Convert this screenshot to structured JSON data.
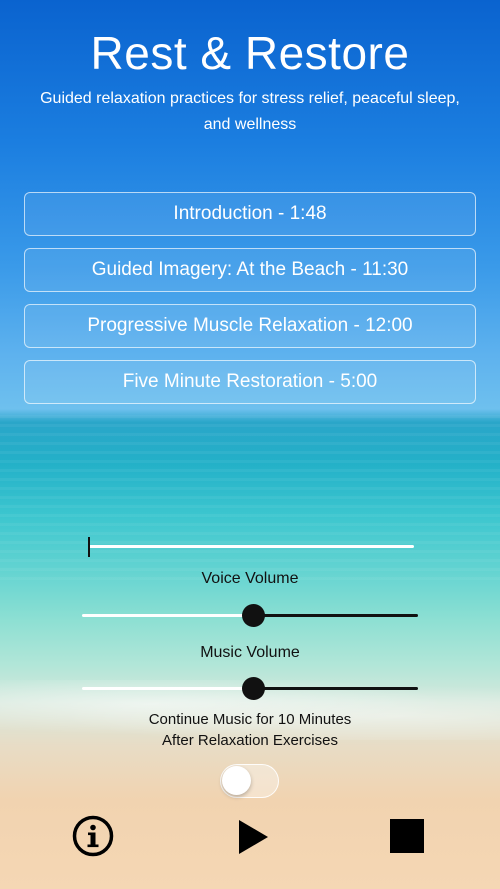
{
  "header": {
    "title": "Rest & Restore",
    "subtitle": "Guided relaxation practices for stress relief, peaceful sleep, and wellness"
  },
  "tracks": [
    {
      "label": "Introduction - 1:48"
    },
    {
      "label": "Guided Imagery: At the Beach - 11:30"
    },
    {
      "label": "Progressive Muscle Relaxation - 12:00"
    },
    {
      "label": "Five Minute Restoration - 5:00"
    }
  ],
  "playback": {
    "progress": 0
  },
  "voice_volume": {
    "label": "Voice Volume",
    "value": 0.51
  },
  "music_volume": {
    "label": "Music Volume",
    "value": 0.51
  },
  "continue_music": {
    "line1": "Continue Music for 10 Minutes",
    "line2": "After Relaxation Exercises",
    "enabled": false
  },
  "controls": {
    "info_icon": "info-circle-icon",
    "play_icon": "play-icon",
    "stop_icon": "stop-icon"
  },
  "colors": {
    "text_light": "#ffffff",
    "text_dark": "#111111",
    "knob": "#111111"
  }
}
